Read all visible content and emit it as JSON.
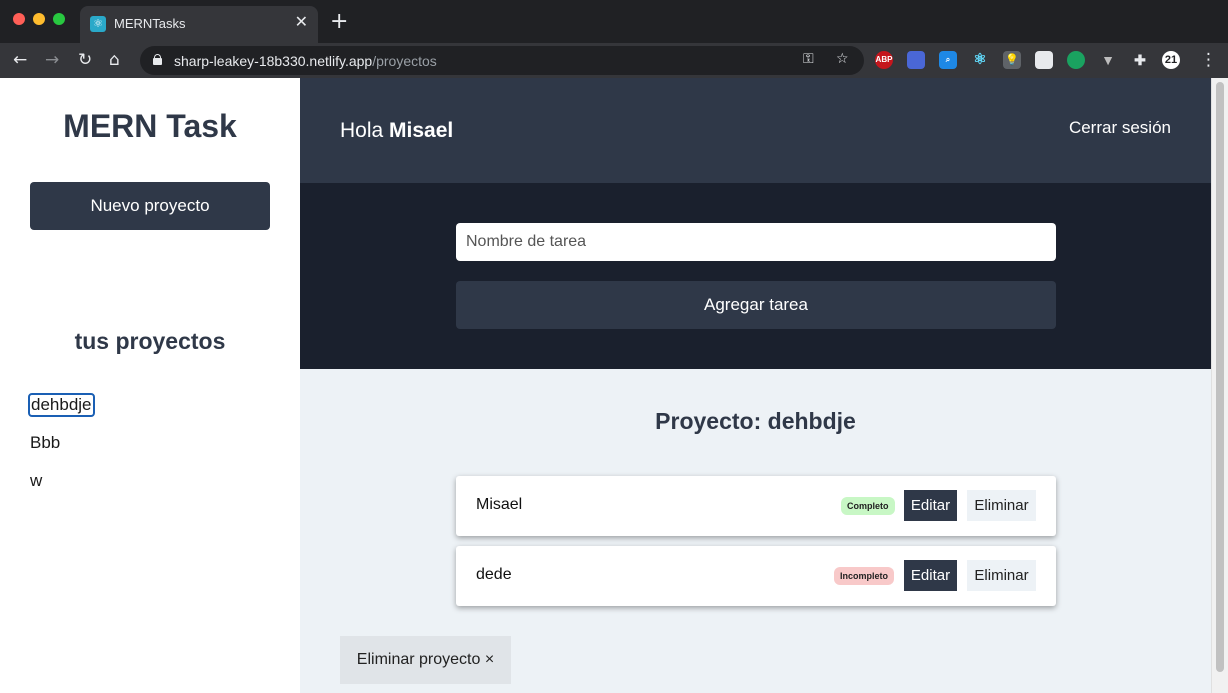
{
  "browser": {
    "tab_title": "MERNTasks",
    "tab_close": "✕",
    "new_tab": "+",
    "url_host": "sharp-leakey-18b330.netlify.app",
    "url_path": "/proyectos",
    "nav": {
      "back": "←",
      "forward": "→",
      "reload": "↻",
      "home": "⌂"
    },
    "extensions": [
      {
        "name": "abp-icon",
        "label": "ABP",
        "color": "#c5161d"
      },
      {
        "name": "wappalyzer-icon",
        "label": "",
        "color": "#4a67d6"
      },
      {
        "name": "search-ext-icon",
        "label": "",
        "color": "#1e88e5"
      },
      {
        "name": "react-devtools-icon",
        "label": "",
        "color": "#35363a"
      },
      {
        "name": "lightbulb-ext-icon",
        "label": "",
        "color": "#5f6368"
      },
      {
        "name": "paint-ext-icon",
        "label": "",
        "color": "#e8eaed"
      },
      {
        "name": "green-dot-icon",
        "label": "",
        "color": "#1aa260"
      },
      {
        "name": "vue-devtools-icon",
        "label": "",
        "color": "#35363a"
      },
      {
        "name": "puzzle-icon",
        "label": "",
        "color": "#35363a"
      },
      {
        "name": "badge-21-icon",
        "label": "21",
        "color": "#ffffff"
      }
    ]
  },
  "sidebar": {
    "logo_bold": "MERN",
    "logo_light": " Task",
    "new_project_label": "Nuevo proyecto",
    "projects_heading": "tus proyectos",
    "projects": [
      "dehbdje",
      "Bbb",
      "w"
    ]
  },
  "header": {
    "greeting_prefix": "Hola ",
    "user_name": "Misael",
    "logout_label": "Cerrar sesión"
  },
  "task_form": {
    "placeholder": "Nombre de tarea",
    "submit_label": "Agregar tarea"
  },
  "project": {
    "title": "Proyecto: dehbdje",
    "tasks": [
      {
        "name": "Misael",
        "status": "Completo",
        "edit": "Editar",
        "delete": "Eliminar"
      },
      {
        "name": "dede",
        "status": "Incompleto",
        "edit": "Editar",
        "delete": "Eliminar"
      }
    ],
    "delete_project_label": "Eliminar proyecto ×"
  },
  "colors": {
    "primary": "#2f3848",
    "dark_panel": "#1a202d",
    "content_bg": "#edf2f6",
    "complete": "#c8f7c5",
    "incomplete": "#f8c9c9"
  }
}
